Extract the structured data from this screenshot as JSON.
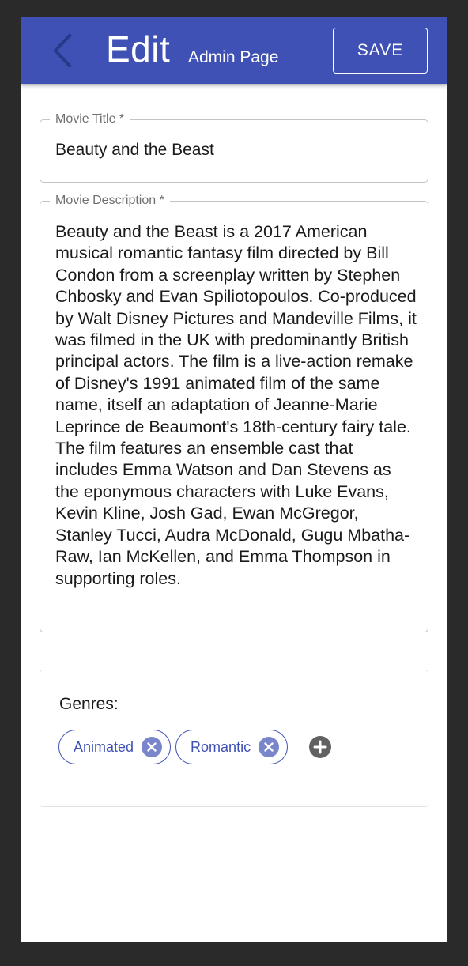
{
  "appbar": {
    "title": "Edit",
    "subtitle": "Admin Page",
    "save_label": "SAVE",
    "back_icon": "chevron-left-icon",
    "background": "#3f51b5"
  },
  "form": {
    "title_field": {
      "label": "Movie Title *",
      "value": "Beauty and the Beast"
    },
    "description_field": {
      "label": "Movie Description *",
      "value": "Beauty and the Beast is a 2017 American musical romantic fantasy film directed by Bill Condon from a screenplay written by Stephen Chbosky and Evan Spiliotopoulos. Co-produced by Walt Disney Pictures and Mandeville Films, it was filmed in the UK with predominantly British principal actors. The film is a live-action remake of Disney's 1991 animated film of the same name, itself an adaptation of Jeanne-Marie Leprince de Beaumont's 18th-century fairy tale. The film features an ensemble cast that includes Emma Watson and Dan Stevens as the eponymous characters with Luke Evans, Kevin Kline, Josh Gad, Ewan McGregor, Stanley Tucci, Audra McDonald, Gugu Mbatha-Raw, Ian McKellen, and Emma Thompson in supporting roles."
    }
  },
  "genres": {
    "label": "Genres:",
    "items": [
      {
        "label": "Animated",
        "delete_icon": "close-circle-icon"
      },
      {
        "label": "Romantic",
        "delete_icon": "close-circle-icon"
      }
    ],
    "add_icon": "add-circle-icon",
    "accent": "#3f51b5"
  }
}
